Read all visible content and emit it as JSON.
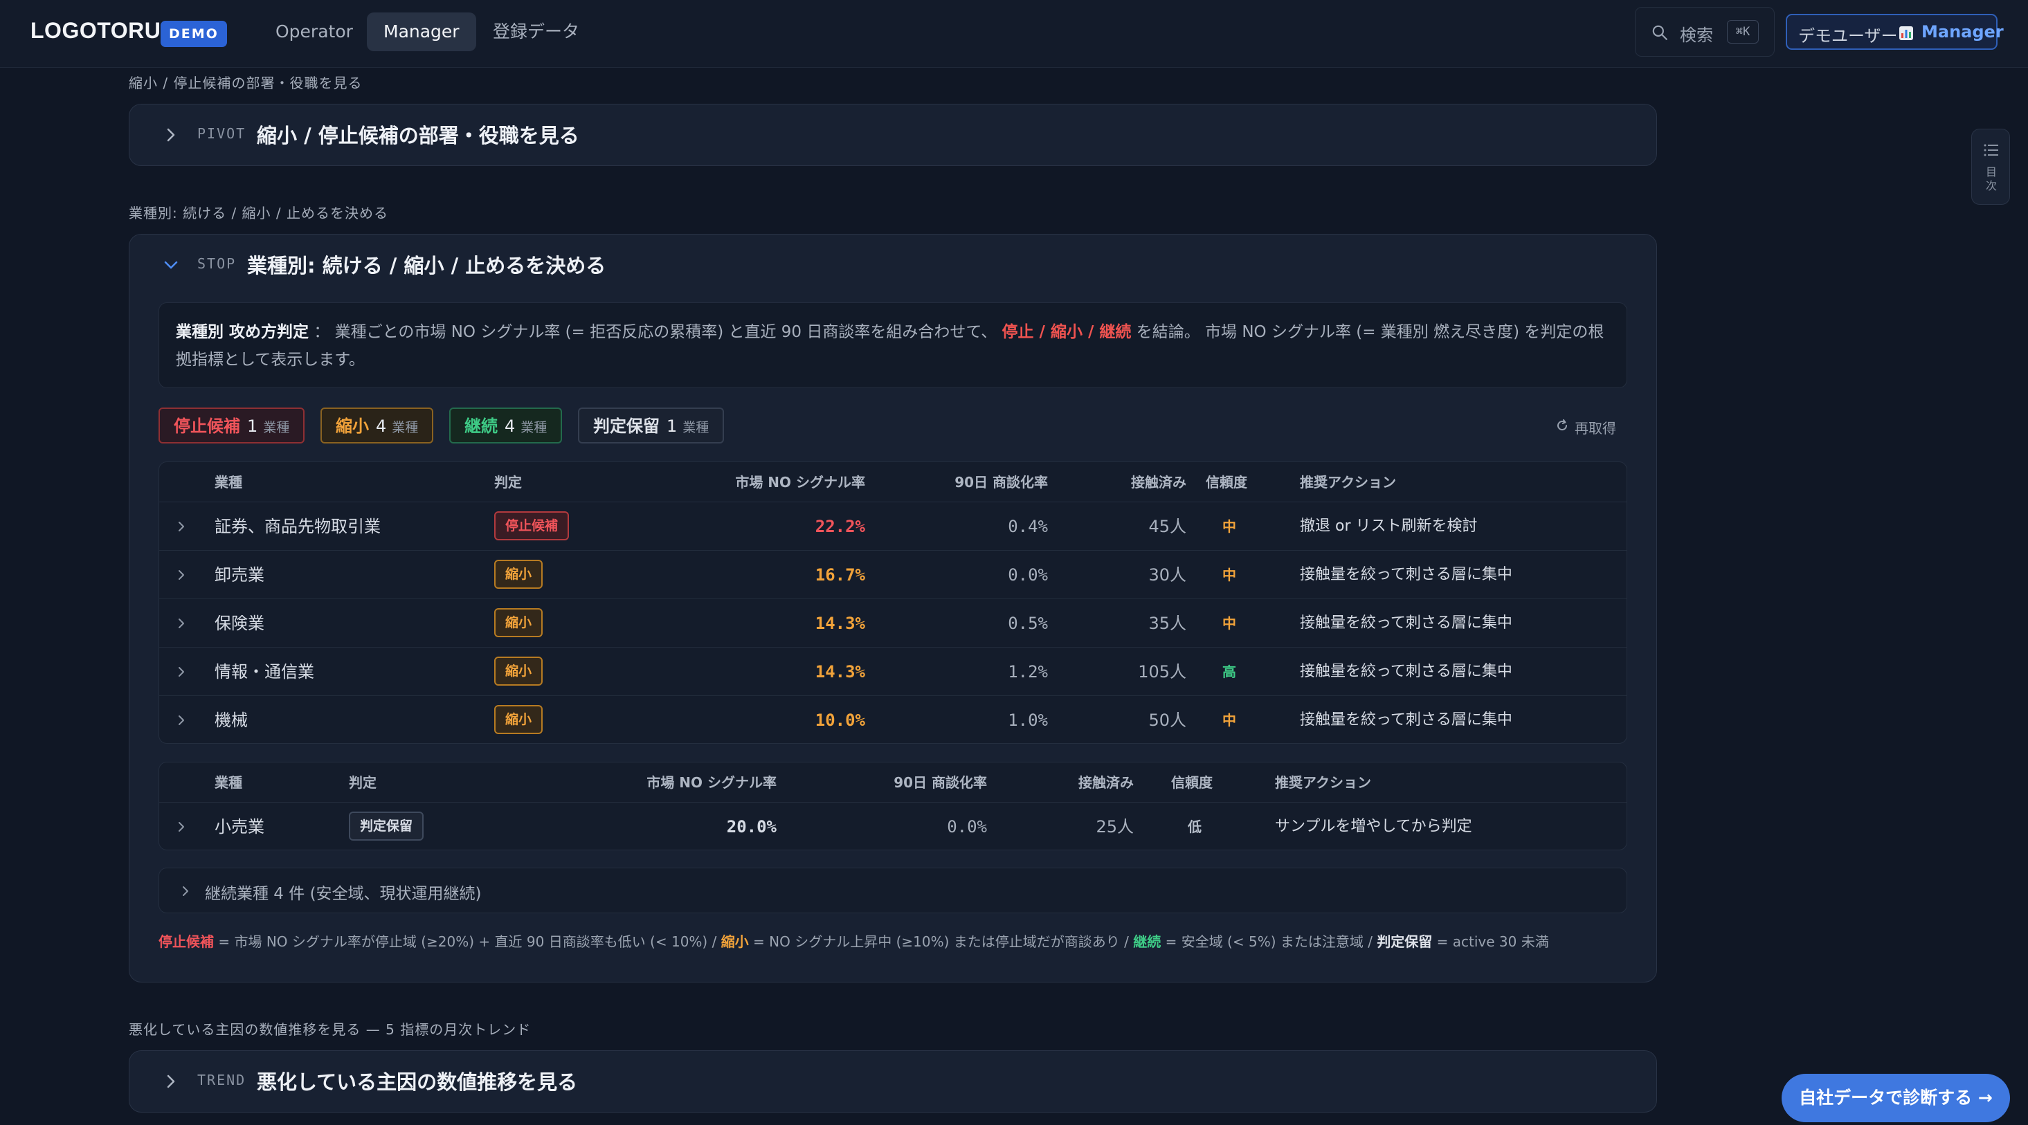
{
  "header": {
    "logo": "LOGOTORU",
    "badge": "DEMO",
    "nav": [
      "Operator",
      "Manager",
      "登録データ"
    ],
    "search_label": "検索",
    "search_shortcut": "⌘K",
    "user_name": "デモユーザー",
    "user_role": "Manager"
  },
  "sections": {
    "pivot": {
      "label": "縮小 / 停止候補の部署・役職を見る",
      "tag": "PIVOT",
      "title": "縮小 / 停止候補の部署・役職を見る"
    },
    "stop": {
      "label": "業種別: 続ける / 縮小 / 止めるを決める",
      "tag": "STOP",
      "title": "業種別: 続ける / 縮小 / 止めるを決める"
    },
    "trend": {
      "label": "悪化している主因の数値推移を見る — 5 指標の月次トレンド",
      "tag": "TREND",
      "title": "悪化している主因の数値推移を見る"
    }
  },
  "info": {
    "heading": "業種別 攻め方判定",
    "text1": "： 業種ごとの市場 NO シグナル率 (= 拒否反応の累積率) と直近 90 日商談率を組み合わせて、",
    "highlight": "停止 / 縮小 / 継続",
    "text2": "を結論。 市場 NO シグナル率 (= 業種別 燃え尽き度) を判定の根拠指標として表示します。"
  },
  "chips": {
    "stop": {
      "label": "停止候補",
      "count": "1",
      "unit": "業種"
    },
    "shrink": {
      "label": "縮小",
      "count": "4",
      "unit": "業種"
    },
    "cont": {
      "label": "継続",
      "count": "4",
      "unit": "業種"
    },
    "hold": {
      "label": "判定保留",
      "count": "1",
      "unit": "業種"
    }
  },
  "refresh_label": "再取得",
  "columns": [
    "業種",
    "判定",
    "市場 NO シグナル率",
    "90日 商談化率",
    "接触済み",
    "信頼度",
    "推奨アクション"
  ],
  "rows": [
    {
      "industry": "証券、商品先物取引業",
      "verdict": "停止候補",
      "no_rate": "22.2%",
      "deal_rate": "0.4%",
      "contacted": "45人",
      "confidence": "中",
      "action": "撤退 or リスト刷新を検討"
    },
    {
      "industry": "卸売業",
      "verdict": "縮小",
      "no_rate": "16.7%",
      "deal_rate": "0.0%",
      "contacted": "30人",
      "confidence": "中",
      "action": "接触量を絞って刺さる層に集中"
    },
    {
      "industry": "保険業",
      "verdict": "縮小",
      "no_rate": "14.3%",
      "deal_rate": "0.5%",
      "contacted": "35人",
      "confidence": "中",
      "action": "接触量を絞って刺さる層に集中"
    },
    {
      "industry": "情報・通信業",
      "verdict": "縮小",
      "no_rate": "14.3%",
      "deal_rate": "1.2%",
      "contacted": "105人",
      "confidence": "高",
      "action": "接触量を絞って刺さる層に集中"
    },
    {
      "industry": "機械",
      "verdict": "縮小",
      "no_rate": "10.0%",
      "deal_rate": "1.0%",
      "contacted": "50人",
      "confidence": "中",
      "action": "接触量を絞って刺さる層に集中"
    }
  ],
  "hold_rows": [
    {
      "industry": "小売業",
      "verdict": "判定保留",
      "no_rate": "20.0%",
      "deal_rate": "0.0%",
      "contacted": "25人",
      "confidence": "低",
      "action": "サンプルを増やしてから判定"
    }
  ],
  "collapsed_label": "継続業種 4 件 (安全域、現状運用継続)",
  "legend": {
    "stop": "停止候補",
    "stop_desc": " = 市場 NO シグナル率が停止域 (≥20%) + 直近 90 日商談率も低い (< 10%) / ",
    "shrink": "縮小",
    "shrink_desc": " = NO シグナル上昇中 (≥10%) または停止域だが商談あり / ",
    "cont": "継続",
    "cont_desc": " = 安全域 (< 5%) または注意域 / ",
    "hold": "判定保留",
    "hold_desc": " = active 30 未満"
  },
  "toc_label": "目次",
  "cta_label": "自社データで診断する →"
}
